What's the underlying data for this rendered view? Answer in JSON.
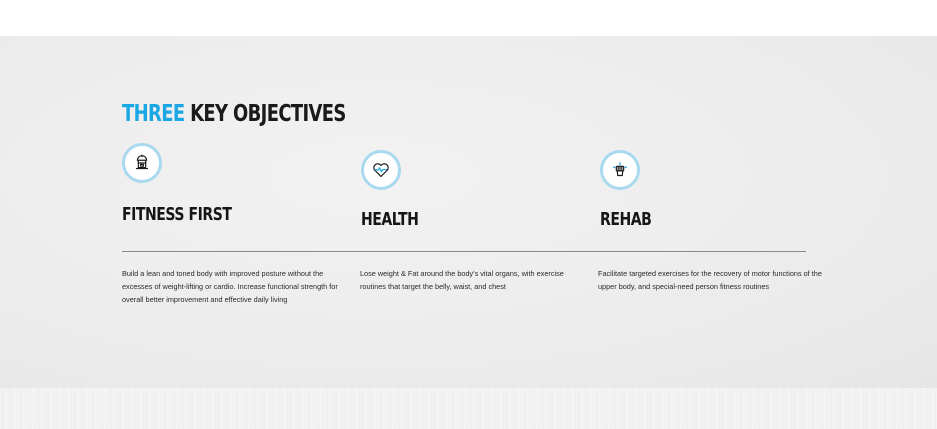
{
  "heading": {
    "accent": "THREE",
    "rest": " KEY OBJECTIVES"
  },
  "objectives": [
    {
      "title": "FITNESS FIRST",
      "icon": "fitness-machine-icon",
      "description": "Build a lean and toned body with improved posture without the excesses of weight-lifting or cardio. Increase functional strength for overall better improvement and effective daily living"
    },
    {
      "title": "HEALTH",
      "icon": "heart-pulse-icon",
      "description": "Lose weight & Fat around the body's vital organs, with exercise routines that target the belly, waist, and chest"
    },
    {
      "title": "REHAB",
      "icon": "rehab-icon",
      "description": "Facilitate targeted exercises for the recovery of motor functions of the upper body, and special-need person fitness routines"
    }
  ],
  "colors": {
    "accent": "#1aa7e4",
    "icon_ring": "#a9d9ef",
    "text": "#1a1a1a"
  }
}
